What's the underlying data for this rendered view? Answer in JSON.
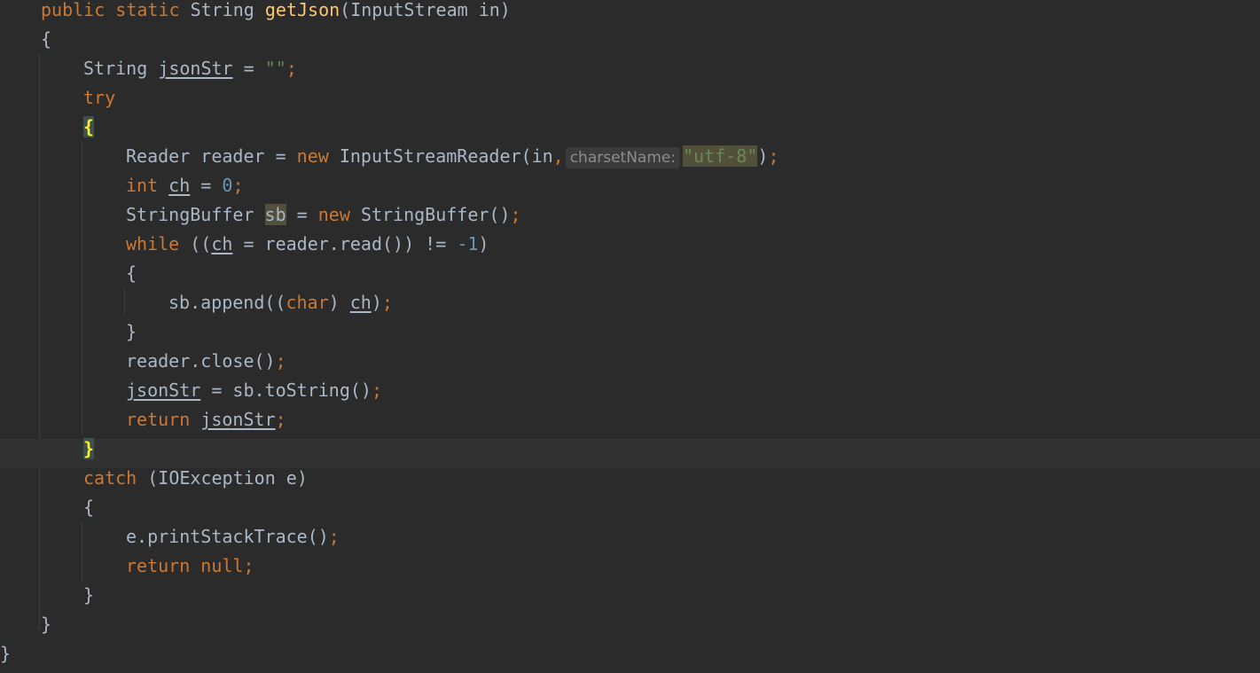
{
  "editor": {
    "colors": {
      "background": "#2b2b2b",
      "current_line": "#323232",
      "keyword": "#cc7832",
      "function": "#ffc66d",
      "string": "#6a8759",
      "number": "#6897bb",
      "text": "#a9b7c6"
    },
    "lines": [
      {
        "t": [
          [
            "kw",
            "public static "
          ],
          [
            "p",
            "String "
          ],
          [
            "fn",
            "getJson"
          ],
          [
            "p",
            "(InputStream in)"
          ]
        ]
      },
      {
        "t": [
          [
            "p",
            "{"
          ]
        ]
      },
      {
        "t": [
          [
            "p",
            "String "
          ],
          [
            "var",
            "jsonStr"
          ],
          [
            "p",
            " = "
          ],
          [
            "str",
            "\"\""
          ],
          [
            "semi",
            ";"
          ]
        ]
      },
      {
        "t": [
          [
            "kw",
            "try"
          ]
        ]
      },
      {
        "t": [
          [
            "brace",
            "{"
          ]
        ]
      },
      {
        "t": [
          [
            "p",
            "Reader reader = "
          ],
          [
            "kw",
            "new "
          ],
          [
            "p",
            "InputStreamReader(in"
          ],
          [
            "semi",
            ","
          ],
          [
            "hint",
            "charsetName:"
          ],
          [
            "strhl",
            "\"utf-8\""
          ],
          [
            "p",
            ")"
          ],
          [
            "semi",
            ";"
          ]
        ]
      },
      {
        "t": [
          [
            "kw",
            "int "
          ],
          [
            "var",
            "ch"
          ],
          [
            "p",
            " = "
          ],
          [
            "num",
            "0"
          ],
          [
            "semi",
            ";"
          ]
        ]
      },
      {
        "t": [
          [
            "p",
            "StringBuffer "
          ],
          [
            "sbhl",
            "sb"
          ],
          [
            "p",
            " = "
          ],
          [
            "kw",
            "new "
          ],
          [
            "p",
            "StringBuffer()"
          ],
          [
            "semi",
            ";"
          ]
        ]
      },
      {
        "t": [
          [
            "kw",
            "while "
          ],
          [
            "p",
            "(("
          ],
          [
            "var",
            "ch"
          ],
          [
            "p",
            " = reader.read()) != "
          ],
          [
            "num",
            "-1"
          ],
          [
            "p",
            ")"
          ]
        ]
      },
      {
        "t": [
          [
            "p",
            "{"
          ]
        ]
      },
      {
        "t": [
          [
            "p",
            "sb.append(("
          ],
          [
            "kw",
            "char"
          ],
          [
            "p",
            ") "
          ],
          [
            "var",
            "ch"
          ],
          [
            "p",
            ")"
          ],
          [
            "semi",
            ";"
          ]
        ]
      },
      {
        "t": [
          [
            "p",
            "}"
          ]
        ]
      },
      {
        "t": [
          [
            "p",
            "reader.close()"
          ],
          [
            "semi",
            ";"
          ]
        ]
      },
      {
        "t": [
          [
            "var",
            "jsonStr"
          ],
          [
            "p",
            " = sb.toString()"
          ],
          [
            "semi",
            ";"
          ]
        ]
      },
      {
        "t": [
          [
            "kw",
            "return "
          ],
          [
            "var",
            "jsonStr"
          ],
          [
            "semi",
            ";"
          ]
        ]
      },
      {
        "t": [
          [
            "brace",
            "}"
          ]
        ],
        "current": true
      },
      {
        "t": [
          [
            "kw",
            "catch "
          ],
          [
            "p",
            "(IOException e)"
          ]
        ]
      },
      {
        "t": [
          [
            "p",
            "{"
          ]
        ]
      },
      {
        "t": [
          [
            "p",
            "e.printStackTrace()"
          ],
          [
            "semi",
            ";"
          ]
        ]
      },
      {
        "t": [
          [
            "kw",
            "return null"
          ],
          [
            "semi",
            ";"
          ]
        ]
      },
      {
        "t": [
          [
            "p",
            "}"
          ]
        ]
      },
      {
        "t": [
          [
            "p",
            "}"
          ]
        ]
      },
      {
        "t": [
          [
            "p",
            "}"
          ]
        ]
      }
    ]
  }
}
